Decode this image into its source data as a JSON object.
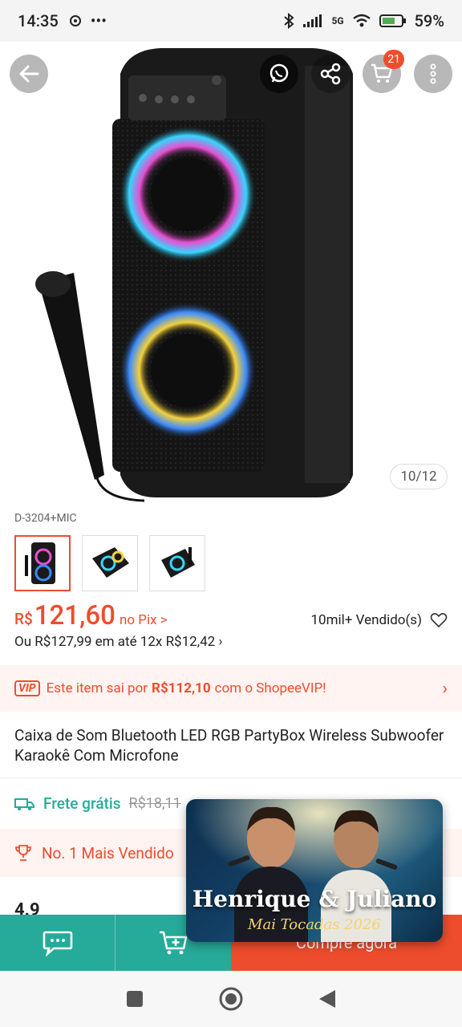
{
  "status_bar": {
    "time": "14:35",
    "dots": "•••",
    "network": "5G",
    "battery": "59%"
  },
  "hero": {
    "image_counter": "10/12",
    "cart_count": "21"
  },
  "product": {
    "variant_code": "D-3204+MIC",
    "thumbnails": [
      "speaker-front",
      "speaker-angle",
      "speaker-side"
    ],
    "price_currency": "R$",
    "price_value": "121,60",
    "price_note": "no Pix >",
    "sold": "10mil+ Vendido(s)",
    "installment": "Ou R$127,99 em até 12x R$12,42 ›",
    "title": "Caixa de Som Bluetooth LED RGB PartyBox Wireless Subwoofer Karaokê Com Microfone"
  },
  "vip": {
    "tag": "VIP",
    "text_before": "Este item sai por",
    "price": "R$112,10",
    "text_after": "com o ShopeeVIP!"
  },
  "shipping": {
    "label": "Frete grátis",
    "old_price": "R$18,11"
  },
  "badge": {
    "text": "No. 1 Mais Vendido"
  },
  "rating_peek": "4.9",
  "bottom_bar": {
    "buy_label": "Compre agora"
  },
  "pip": {
    "title": "Henrique & Juliano",
    "subtitle": "Mai Tocadas 2026"
  },
  "colors": {
    "accent": "#ee4d2d",
    "teal": "#26aa99"
  }
}
